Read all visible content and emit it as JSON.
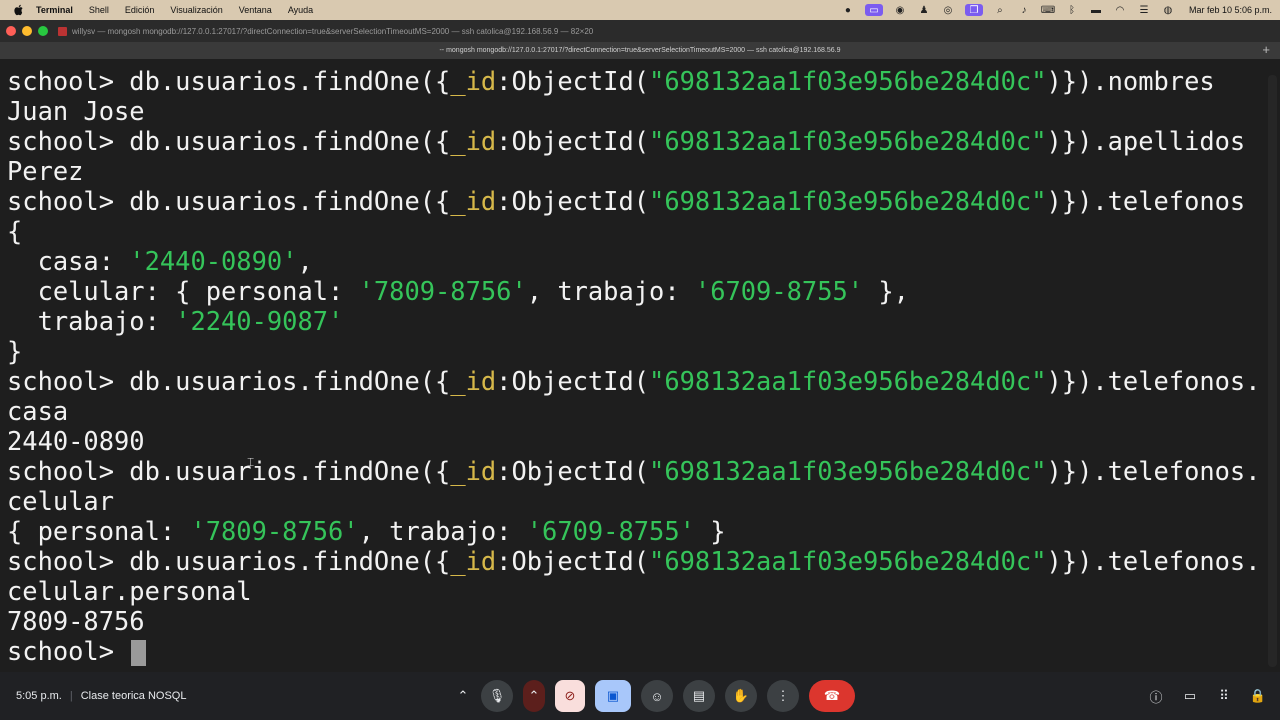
{
  "menubar": {
    "apple": "",
    "items": [
      "Terminal",
      "Shell",
      "Edición",
      "Visualización",
      "Ventana",
      "Ayuda"
    ],
    "clock": "Mar feb 10  5:06 p.m."
  },
  "window": {
    "title": "willysv — mongosh mongodb://127.0.0.1:27017/?directConnection=true&serverSelectionTimeoutMS=2000 — ssh catolica@192.168.56.9 — 82×20",
    "tab_title": "-- mongosh mongodb://127.0.0.1:27017/?directConnection=true&serverSelectionTimeoutMS=2000 — ssh catolica@192.168.56.9"
  },
  "terminal": {
    "prompt": "school> ",
    "cmd_prefix": "db.usuarios.findOne({",
    "id_key": "_id",
    "objectid_fn": ":ObjectId(",
    "objectid_value": "\"698132aa1f03e956be284d0c\"",
    "cmd_close": ")})",
    "fields": {
      "nombres": ".nombres",
      "apellidos": ".apellidos",
      "telefonos": ".telefonos",
      "telefonos_dot": ".telefonos."
    },
    "outputs": {
      "nombres": "Juan Jose",
      "apellidos": "Perez",
      "open_brace": "{",
      "casa_key": "  casa: ",
      "casa_value": "'2440-0890'",
      "comma": ",",
      "celular_key": "  celular: { personal: ",
      "celular_personal": "'7809-8756'",
      "celular_mid": ", trabajo: ",
      "celular_trabajo": "'6709-8755'",
      "celular_end": " },",
      "trabajo_key": "  trabajo: ",
      "trabajo_value": "'2240-9087'",
      "close_brace": "}",
      "cont_casa": "casa",
      "casa_plain": "2440-0890",
      "cont_celular": "celular",
      "celular_obj_start": "{ personal: ",
      "celular_obj_personal": "'7809-8756'",
      "celular_obj_mid": ", trabajo: ",
      "celular_obj_trabajo": "'6709-8755'",
      "celular_obj_end": " }",
      "cont_celular_personal": "celular.personal",
      "personal_plain": "7809-8756"
    }
  },
  "meet": {
    "time": "5:05 p.m.",
    "separator": "|",
    "meeting_name": "Clase teorica NOSQL"
  }
}
